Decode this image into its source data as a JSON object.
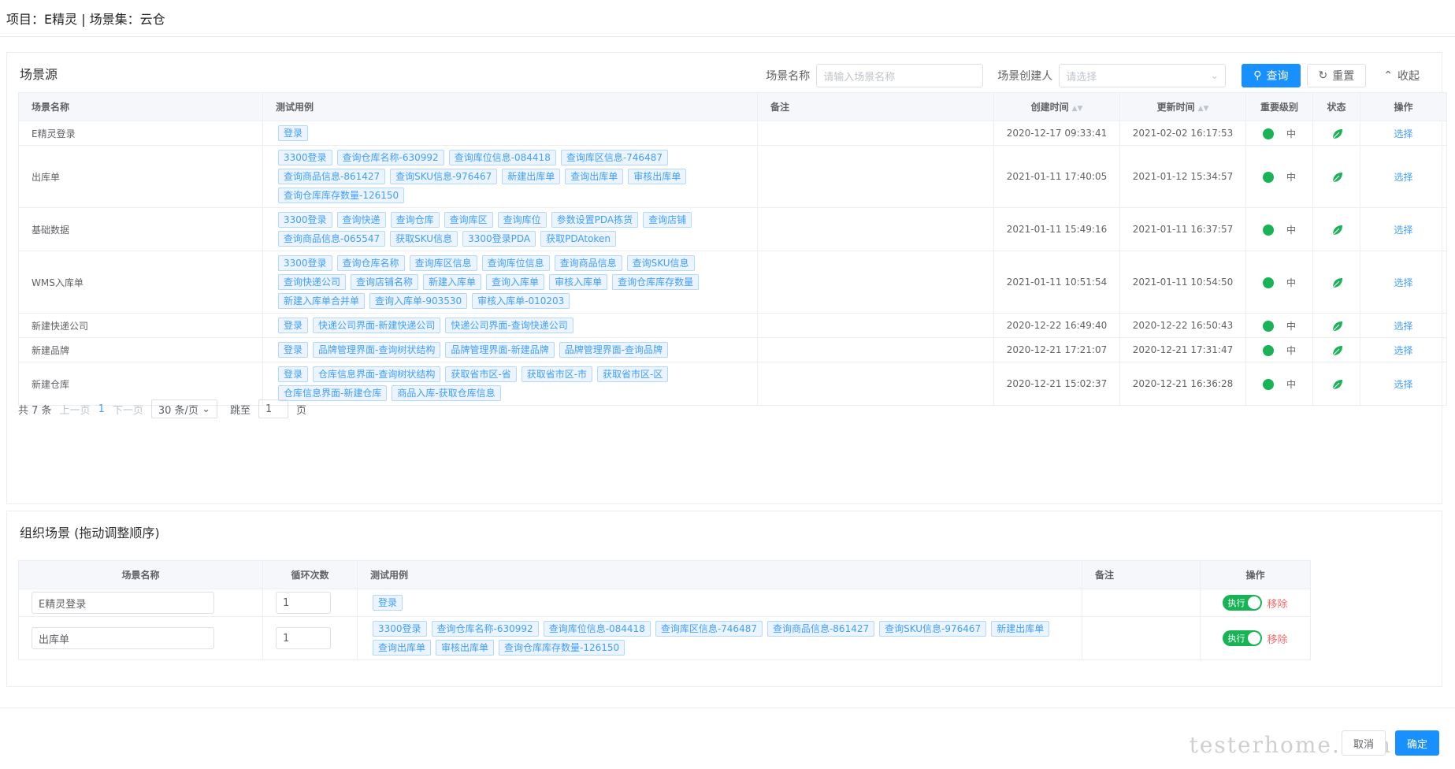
{
  "header": {
    "title": "项目：E精灵 | 场景集：云仓"
  },
  "source": {
    "title": "场景源",
    "search": {
      "name_label": "场景名称",
      "name_placeholder": "请输入场景名称",
      "creator_label": "场景创建人",
      "creator_placeholder": "请选择",
      "query_label": "查询",
      "reset_label": "重置",
      "collapse_label": "收起"
    },
    "columns": {
      "name": "场景名称",
      "cases": "测试用例",
      "note": "备注",
      "created": "创建时间",
      "updated": "更新时间",
      "level": "重要级别",
      "status": "状态",
      "action": "操作"
    },
    "rows": [
      {
        "name": "E精灵登录",
        "cases": [
          "登录"
        ],
        "created": "2020-12-17 09:33:41",
        "updated": "2021-02-02 16:17:53",
        "level": "中",
        "action": "选择"
      },
      {
        "name": "出库单",
        "cases": [
          "3300登录",
          "查询仓库名称-630992",
          "查询库位信息-084418",
          "查询库区信息-746487",
          "查询商品信息-861427",
          "查询SKU信息-976467",
          "新建出库单",
          "查询出库单",
          "审核出库单",
          "查询仓库库存数量-126150"
        ],
        "created": "2021-01-11 17:40:05",
        "updated": "2021-01-12 15:34:57",
        "level": "中",
        "action": "选择"
      },
      {
        "name": "基础数据",
        "cases": [
          "3300登录",
          "查询快递",
          "查询仓库",
          "查询库区",
          "查询库位",
          "参数设置PDA拣货",
          "查询店铺",
          "查询商品信息-065547",
          "获取SKU信息",
          "3300登录PDA",
          "获取PDAtoken"
        ],
        "created": "2021-01-11 15:49:16",
        "updated": "2021-01-11 16:37:57",
        "level": "中",
        "action": "选择"
      },
      {
        "name": "WMS入库单",
        "cases": [
          "3300登录",
          "查询仓库名称",
          "查询库区信息",
          "查询库位信息",
          "查询商品信息",
          "查询SKU信息",
          "查询快递公司",
          "查询店铺名称",
          "新建入库单",
          "查询入库单",
          "审核入库单",
          "查询仓库库存数量",
          "新建入库单合并单",
          "查询入库单-903530",
          "审核入库单-010203"
        ],
        "created": "2021-01-11 10:51:54",
        "updated": "2021-01-11 10:54:50",
        "level": "中",
        "action": "选择"
      },
      {
        "name": "新建快递公司",
        "cases": [
          "登录",
          "快递公司界面-新建快递公司",
          "快递公司界面-查询快递公司"
        ],
        "created": "2020-12-22 16:49:40",
        "updated": "2020-12-22 16:50:43",
        "level": "中",
        "action": "选择"
      },
      {
        "name": "新建品牌",
        "cases": [
          "登录",
          "品牌管理界面-查询树状结构",
          "品牌管理界面-新建品牌",
          "品牌管理界面-查询品牌"
        ],
        "created": "2020-12-21 17:21:07",
        "updated": "2020-12-21 17:31:47",
        "level": "中",
        "action": "选择"
      },
      {
        "name": "新建仓库",
        "cases": [
          "登录",
          "仓库信息界面-查询树状结构",
          "获取省市区-省",
          "获取省市区-市",
          "获取省市区-区",
          "仓库信息界面-新建仓库",
          "商品入库-获取仓库信息"
        ],
        "created": "2020-12-21 15:02:37",
        "updated": "2020-12-21 16:36:28",
        "level": "中",
        "action": "选择"
      }
    ],
    "pager": {
      "total": "共 7 条",
      "prev": "上一页",
      "page": "1",
      "next": "下一页",
      "size": "30 条/页",
      "jump": "跳至",
      "jump_value": "1",
      "unit": "页"
    }
  },
  "org": {
    "title": "组织场景 (拖动调整顺序)",
    "columns": {
      "name": "场景名称",
      "loops": "循环次数",
      "cases": "测试用例",
      "note": "备注",
      "action": "操作"
    },
    "rows": [
      {
        "name": "E精灵登录",
        "loops": "1",
        "cases": [
          "登录"
        ],
        "exec": "执行",
        "remove": "移除"
      },
      {
        "name": "出库单",
        "loops": "1",
        "cases": [
          "3300登录",
          "查询仓库名称-630992",
          "查询库位信息-084418",
          "查询库区信息-746487",
          "查询商品信息-861427",
          "查询SKU信息-976467",
          "新建出库单",
          "查询出库单",
          "审核出库单",
          "查询仓库库存数量-126150"
        ],
        "exec": "执行",
        "remove": "移除"
      }
    ]
  },
  "footer": {
    "cancel": "取消",
    "ok": "确定",
    "watermark": "testerhome.com"
  },
  "colors": {
    "accent": "#1890ff",
    "status_green": "#17b355",
    "tag_blue": "#409eff",
    "danger": "#f56c6c"
  }
}
